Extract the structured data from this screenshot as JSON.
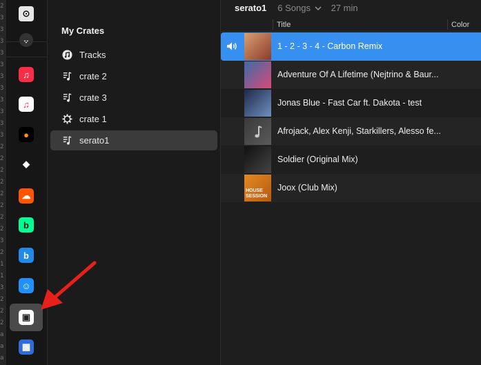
{
  "edge_chars": [
    "2",
    "3",
    "3",
    "3",
    "3",
    "3",
    "3",
    "3",
    "3",
    "3",
    "3",
    "3",
    "2",
    "2",
    "2",
    "2",
    "2",
    "2",
    "2",
    "2",
    "3",
    "2",
    "1",
    "1",
    "3",
    "2",
    "2",
    "2",
    "a",
    "a",
    "a"
  ],
  "dock": {
    "items": [
      {
        "name": "playback-control-icon",
        "bg": "#e6e6e6",
        "fg": "#111111",
        "glyph": "⊙"
      },
      {
        "name": "collapse-toggle-icon",
        "bg": "#333333",
        "fg": "#ffffff",
        "glyph": "⌄"
      },
      {
        "name": "apple-music-icon",
        "bg": "#fa2d48",
        "fg": "#ffffff",
        "glyph": "♫"
      },
      {
        "name": "itunes-icon",
        "bg": "#ffffff",
        "fg": "#f0305f",
        "glyph": "♫"
      },
      {
        "name": "beatport-orange-icon",
        "bg": "#000000",
        "fg": "#f7931e",
        "glyph": "●"
      },
      {
        "name": "tidal-icon",
        "bg": "#161616",
        "fg": "#ffffff",
        "glyph": "◆"
      },
      {
        "name": "soundcloud-icon",
        "bg": "#ff5500",
        "fg": "#ffffff",
        "glyph": "☁"
      },
      {
        "name": "beatport-icon",
        "bg": "#01ff95",
        "fg": "#111111",
        "glyph": "b"
      },
      {
        "name": "beatsource-icon",
        "bg": "#2189e8",
        "fg": "#ffffff",
        "glyph": "b"
      },
      {
        "name": "finder-icon",
        "bg": "#1e90ff",
        "fg": "#ffffff",
        "glyph": "☺"
      },
      {
        "name": "crates-box-icon",
        "bg": "#ffffff",
        "fg": "#222222",
        "glyph": "▣"
      },
      {
        "name": "video-film-icon",
        "bg": "#2f6cd8",
        "fg": "#ffffff",
        "glyph": "▦"
      }
    ]
  },
  "crates": {
    "heading": "My Crates",
    "items": [
      {
        "label": "Tracks",
        "icon": "music-note-icon"
      },
      {
        "label": "crate 2",
        "icon": "playlist-icon"
      },
      {
        "label": "crate 3",
        "icon": "playlist-icon"
      },
      {
        "label": "crate 1",
        "icon": "gear-crate-icon"
      },
      {
        "label": "serato1",
        "icon": "playlist-icon"
      }
    ],
    "selected_index": 4
  },
  "header": {
    "crate_name": "serato1",
    "song_count": "6 Songs",
    "duration": "27 min"
  },
  "columns": {
    "title": "Title",
    "color": "Color"
  },
  "tracks": [
    {
      "title": "1 - 2 - 3 - 4 - Carbon Remix",
      "art": "#d9a070",
      "art2": "#8b3a2a",
      "playing": true
    },
    {
      "title": "Adventure Of A Lifetime (Nejtrino & Baur...",
      "art": "#3b6ca8",
      "art2": "#d94a7a",
      "playing": false
    },
    {
      "title": "Jonas Blue - Fast Car ft. Dakota - test",
      "art": "#1d2a4a",
      "art2": "#6f8fc0",
      "playing": false
    },
    {
      "title": "Afrojack, Alex Kenji, Starkillers, Alesso fe...",
      "art": "#3a3a3a",
      "art2": "#5a5a5a",
      "playing": false
    },
    {
      "title": "Soldier (Original Mix)",
      "art": "#111111",
      "art2": "#444444",
      "playing": false
    },
    {
      "title": "Joox (Club Mix)",
      "art": "#e08a22",
      "art2": "#b85a10",
      "playing": false
    }
  ],
  "joox_art_text": "HOUSE SESSION",
  "colors": {
    "accent": "#3790f0",
    "annotation_arrow": "#e8201c"
  }
}
